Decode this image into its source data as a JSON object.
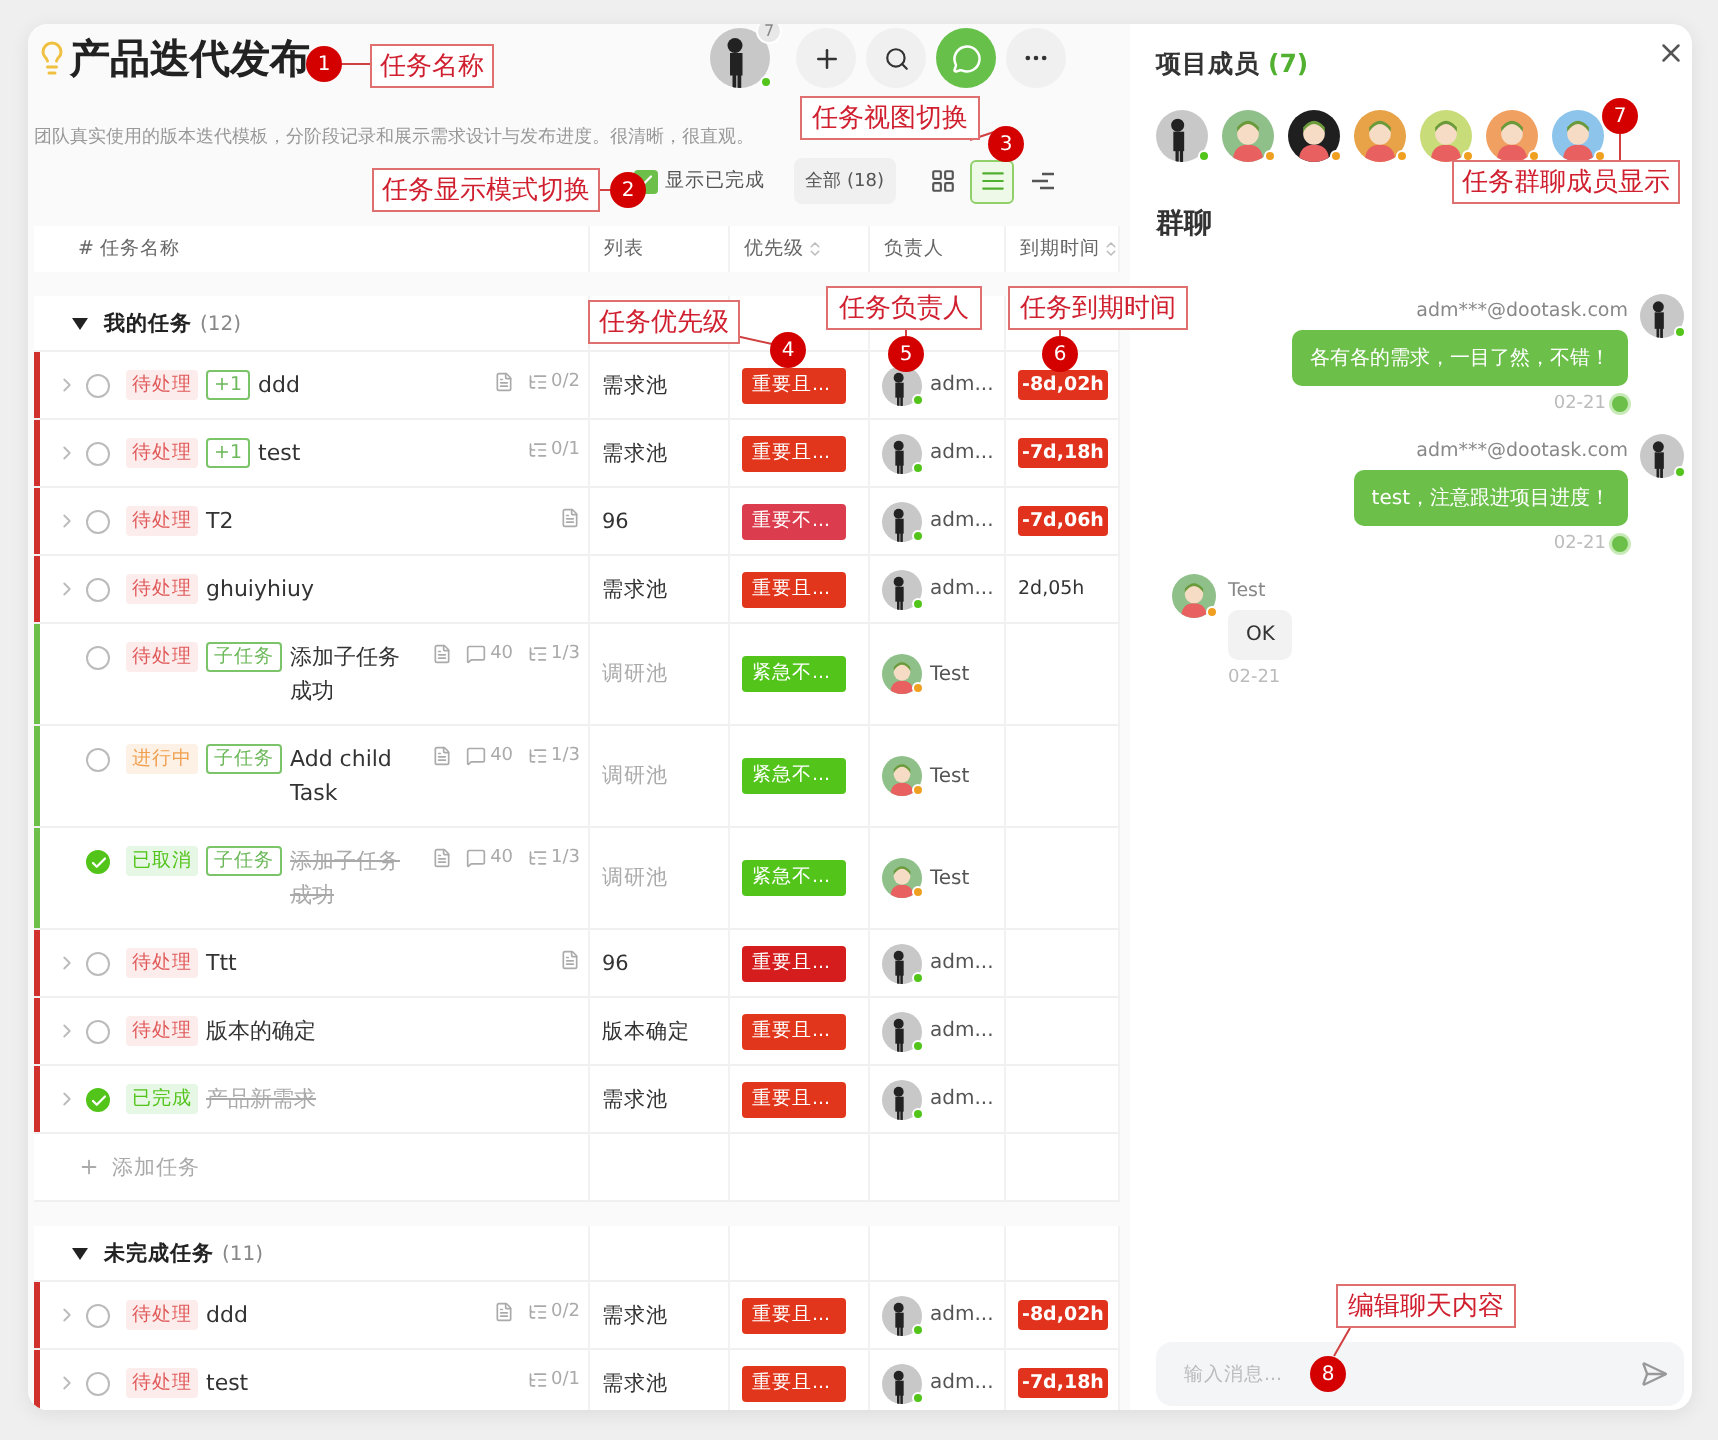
{
  "header": {
    "title": "产品迭代发布",
    "owner": {
      "kind": "photo",
      "online": true
    },
    "avatar_badge": "7",
    "chat_open": true
  },
  "description": "团队真实使用的版本迭代模板，分阶段记录和展示需求设计与发布进度。很清晰，很直观。",
  "toolbar": {
    "show_completed": {
      "label": "显示已完成",
      "checked": true
    },
    "filter": "全部 (18)",
    "views": [
      {
        "kind": "grid",
        "selected": false
      },
      {
        "kind": "list",
        "selected": true
      },
      {
        "kind": "gantt",
        "selected": false
      }
    ]
  },
  "table": {
    "columns": [
      {
        "label": "# 任务名称",
        "sortable": false
      },
      {
        "label": "列表",
        "sortable": false
      },
      {
        "label": "优先级",
        "sortable": true
      },
      {
        "label": "负责人",
        "sortable": false
      },
      {
        "label": "到期时间",
        "sortable": true
      }
    ],
    "groups": [
      {
        "title": "我的任务",
        "count": "(12)",
        "expanded": true,
        "add_label": "添加任务",
        "rows": [
          {
            "color": "#d0312d",
            "expandable": true,
            "done": false,
            "status": {
              "label": "待处理",
              "kind": "pending"
            },
            "tag": "+1",
            "title": "ddd",
            "has_doc": true,
            "subtasks": "0/2",
            "list": "需求池",
            "list_dimmed": false,
            "priority": {
              "label": "重要且...",
              "color": "#e2361c"
            },
            "owner": {
              "name": "adm...",
              "kind": "photo",
              "online": true
            },
            "due": {
              "label": "-8d,02h",
              "overdue": true
            }
          },
          {
            "color": "#d0312d",
            "expandable": true,
            "done": false,
            "status": {
              "label": "待处理",
              "kind": "pending"
            },
            "tag": "+1",
            "title": "test",
            "has_doc": false,
            "subtasks": "0/1",
            "list": "需求池",
            "list_dimmed": false,
            "priority": {
              "label": "重要且...",
              "color": "#e2361c"
            },
            "owner": {
              "name": "adm...",
              "kind": "photo",
              "online": true
            },
            "due": {
              "label": "-7d,18h",
              "overdue": true
            }
          },
          {
            "color": "#d0312d",
            "expandable": true,
            "done": false,
            "status": {
              "label": "待处理",
              "kind": "pending"
            },
            "title": "T2",
            "has_doc": true,
            "list": "96",
            "list_dimmed": false,
            "priority": {
              "label": "重要不...",
              "color": "#dc3d4e"
            },
            "owner": {
              "name": "adm...",
              "kind": "photo",
              "online": true
            },
            "due": {
              "label": "-7d,06h",
              "overdue": true
            }
          },
          {
            "color": "#d0312d",
            "expandable": true,
            "done": false,
            "status": {
              "label": "待处理",
              "kind": "pending"
            },
            "title": "ghuiyhiuy",
            "has_doc": false,
            "list": "需求池",
            "list_dimmed": false,
            "priority": {
              "label": "重要且...",
              "color": "#e2361c"
            },
            "owner": {
              "name": "adm...",
              "kind": "photo",
              "online": true
            },
            "due": {
              "label": "2d,05h",
              "overdue": false
            }
          },
          {
            "color": "#6cc04a",
            "expandable": false,
            "done": false,
            "status": {
              "label": "待处理",
              "kind": "pending"
            },
            "tag": "子任务",
            "title": "添加子任务成功",
            "has_doc": true,
            "comments": "40",
            "subtasks": "1/3",
            "list": "调研池",
            "list_dimmed": true,
            "priority": {
              "label": "紧急不...",
              "color": "#52c41a"
            },
            "owner": {
              "name": "Test",
              "kind": "cartoon",
              "color": "#8fc08a",
              "online": false
            }
          },
          {
            "color": "#6cc04a",
            "expandable": false,
            "done": false,
            "status": {
              "label": "进行中",
              "kind": "progress"
            },
            "tag": "子任务",
            "title": "Add child Task",
            "has_doc": true,
            "comments": "40",
            "subtasks": "1/3",
            "list": "调研池",
            "list_dimmed": true,
            "priority": {
              "label": "紧急不...",
              "color": "#52c41a"
            },
            "owner": {
              "name": "Test",
              "kind": "cartoon",
              "color": "#8fc08a",
              "online": false
            }
          },
          {
            "color": "#6cc04a",
            "expandable": false,
            "done": true,
            "status": {
              "label": "已取消",
              "kind": "finished"
            },
            "tag": "子任务",
            "title": "添加子任务成功",
            "has_doc": true,
            "comments": "40",
            "subtasks": "1/3",
            "list": "调研池",
            "list_dimmed": true,
            "priority": {
              "label": "紧急不...",
              "color": "#52c41a"
            },
            "owner": {
              "name": "Test",
              "kind": "cartoon",
              "color": "#8fc08a",
              "online": false
            }
          },
          {
            "color": "#d0312d",
            "expandable": true,
            "done": false,
            "status": {
              "label": "待处理",
              "kind": "pending"
            },
            "title": "Ttt",
            "has_doc": true,
            "list": "96",
            "list_dimmed": false,
            "priority": {
              "label": "重要且...",
              "color": "#d51d1d"
            },
            "owner": {
              "name": "adm...",
              "kind": "photo",
              "online": true
            }
          },
          {
            "color": "#d0312d",
            "expandable": true,
            "done": false,
            "status": {
              "label": "待处理",
              "kind": "pending"
            },
            "title": "版本的确定",
            "has_doc": false,
            "list": "版本确定",
            "list_dimmed": false,
            "priority": {
              "label": "重要且...",
              "color": "#e2361c"
            },
            "owner": {
              "name": "adm...",
              "kind": "photo",
              "online": true
            }
          },
          {
            "color": "#d0312d",
            "expandable": true,
            "done": true,
            "status": {
              "label": "已完成",
              "kind": "finished"
            },
            "title": "产品新需求",
            "has_doc": false,
            "list": "需求池",
            "list_dimmed": false,
            "priority": {
              "label": "重要且...",
              "color": "#e2361c"
            },
            "owner": {
              "name": "adm...",
              "kind": "photo",
              "online": true
            }
          }
        ]
      },
      {
        "title": "未完成任务",
        "count": "(11)",
        "expanded": true,
        "rows": [
          {
            "color": "#d0312d",
            "expandable": true,
            "done": false,
            "status": {
              "label": "待处理",
              "kind": "pending"
            },
            "title": "ddd",
            "has_doc": true,
            "subtasks": "0/2",
            "list": "需求池",
            "list_dimmed": false,
            "priority": {
              "label": "重要且...",
              "color": "#e2361c"
            },
            "owner": {
              "name": "adm...",
              "kind": "photo",
              "online": true
            },
            "due": {
              "label": "-8d,02h",
              "overdue": true
            }
          },
          {
            "color": "#d0312d",
            "expandable": true,
            "done": false,
            "status": {
              "label": "待处理",
              "kind": "pending"
            },
            "title": "test",
            "has_doc": false,
            "subtasks": "0/1",
            "list": "需求池",
            "list_dimmed": false,
            "priority": {
              "label": "重要且...",
              "color": "#e2361c"
            },
            "owner": {
              "name": "adm...",
              "kind": "photo",
              "online": true
            },
            "due": {
              "label": "-7d,18h",
              "overdue": true
            }
          }
        ]
      }
    ]
  },
  "members_panel": {
    "title": "项目成员",
    "count": "(7)",
    "members": [
      {
        "kind": "photo",
        "online": true
      },
      {
        "kind": "cartoon",
        "color": "#8fc08a",
        "online": false
      },
      {
        "kind": "cartoon",
        "color": "#1f1f1f",
        "online": false
      },
      {
        "kind": "cartoon",
        "color": "#e8a248",
        "online": false
      },
      {
        "kind": "cartoon",
        "color": "#c9dc7a",
        "online": false
      },
      {
        "kind": "cartoon",
        "color": "#f0a060",
        "online": false
      },
      {
        "kind": "cartoon",
        "color": "#8cc4ec",
        "online": false
      }
    ]
  },
  "chat": {
    "title": "群聊",
    "messages": [
      {
        "kind": "self",
        "sender": "adm***@dootask.com",
        "avatar": {
          "kind": "photo",
          "online": true
        },
        "text": "各有各的需求，一目了然，不错！",
        "time": "02-21",
        "read": true
      },
      {
        "kind": "self",
        "sender": "adm***@dootask.com",
        "avatar": {
          "kind": "photo",
          "online": true
        },
        "text": "test，注意跟进项目进度！",
        "time": "02-21",
        "read": true
      },
      {
        "kind": "other",
        "sender": "Test",
        "avatar": {
          "kind": "cartoon",
          "color": "#8fc08a",
          "online": false
        },
        "text": "OK",
        "time": "02-21"
      }
    ],
    "placeholder": "输入消息..."
  },
  "annotations": [
    {
      "number": "1",
      "label": "任务名称"
    },
    {
      "number": "2",
      "label": "任务显示模式切换"
    },
    {
      "number": "3",
      "label": "任务视图切换"
    },
    {
      "number": "4",
      "label": "任务优先级"
    },
    {
      "number": "5",
      "label": "任务负责人"
    },
    {
      "number": "6",
      "label": "任务到期时间"
    },
    {
      "number": "7",
      "label": "任务群聊成员显示"
    },
    {
      "number": "8",
      "label": "编辑聊天内容"
    }
  ]
}
